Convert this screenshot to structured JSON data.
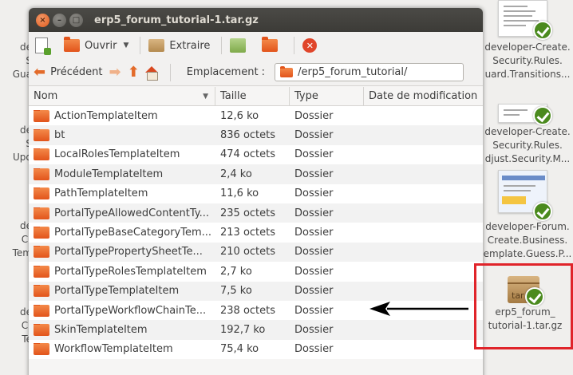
{
  "window": {
    "title": "erp5_forum_tutorial-1.tar.gz",
    "close_glyph": "×",
    "min_glyph": "–",
    "max_glyph": "□"
  },
  "toolbar": {
    "open_label": "Ouvrir",
    "open_caret": "▼",
    "extract_label": "Extraire",
    "stop_glyph": "✕"
  },
  "navbar": {
    "back_label": "Précédent",
    "location_label": "Emplacement :",
    "location_value": "/erp5_forum_tutorial/"
  },
  "table": {
    "headers": {
      "name": "Nom",
      "size": "Taille",
      "type": "Type",
      "modified": "Date de modification"
    },
    "sort_glyph": "▼",
    "rows": [
      {
        "name": "ActionTemplateItem",
        "size": "12,6 ko",
        "type": "Dossier"
      },
      {
        "name": "bt",
        "size": "836 octets",
        "type": "Dossier"
      },
      {
        "name": "LocalRolesTemplateItem",
        "size": "474 octets",
        "type": "Dossier"
      },
      {
        "name": "ModuleTemplateItem",
        "size": "2,4 ko",
        "type": "Dossier"
      },
      {
        "name": "PathTemplateItem",
        "size": "11,6 ko",
        "type": "Dossier"
      },
      {
        "name": "PortalTypeAllowedContentTy...",
        "size": "235 octets",
        "type": "Dossier"
      },
      {
        "name": "PortalTypeBaseCategoryTem...",
        "size": "213 octets",
        "type": "Dossier"
      },
      {
        "name": "PortalTypePropertySheetTe...",
        "size": "210 octets",
        "type": "Dossier"
      },
      {
        "name": "PortalTypeRolesTemplateItem",
        "size": "2,7 ko",
        "type": "Dossier"
      },
      {
        "name": "PortalTypeTemplateItem",
        "size": "7,5 ko",
        "type": "Dossier"
      },
      {
        "name": "PortalTypeWorkflowChainTe...",
        "size": "238 octets",
        "type": "Dossier"
      },
      {
        "name": "SkinTemplateItem",
        "size": "192,7 ko",
        "type": "Dossier"
      },
      {
        "name": "WorkflowTemplateItem",
        "size": "75,4 ko",
        "type": "Dossier"
      }
    ]
  },
  "desktop": {
    "right_icons": [
      {
        "lines": [
          "developer-Create.",
          "Security.Rules.",
          "uard.Transitions..."
        ]
      },
      {
        "lines": [
          "developer-Create.",
          "Security.Rules.",
          "djust.Security.M..."
        ]
      },
      {
        "lines": [
          "developer-Forum.",
          "Create.Business.",
          "emplate.Guess.P..."
        ]
      }
    ],
    "tar_icon": {
      "badge": "tar",
      "lines": [
        "erp5_forum_",
        "tutorial-1.tar.gz"
      ]
    },
    "left_fragments": [
      [
        "de",
        "S",
        "Gua"
      ],
      [
        "de",
        "S",
        "Upd"
      ],
      [
        "de",
        "Cr",
        "Tem"
      ],
      [
        "de",
        "Cr",
        "Te"
      ]
    ]
  },
  "colors": {
    "accent_orange": "#e2541b",
    "annotation_red": "#e0242a",
    "check_green": "#4b8a1e"
  }
}
